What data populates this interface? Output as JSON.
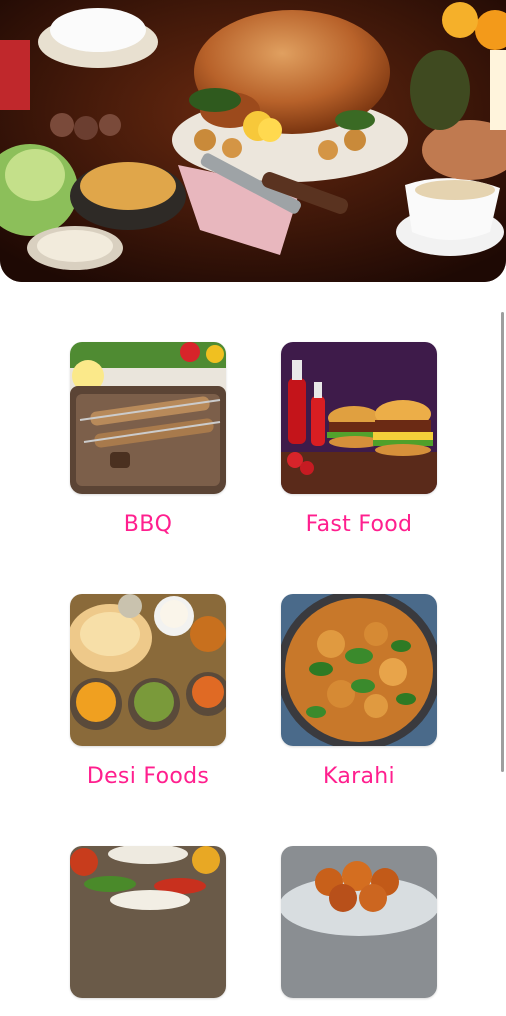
{
  "theme": {
    "accent": "#ff1f8e",
    "background": "#ffffff"
  },
  "hero": {
    "image": "holiday-feast-roast-turkey"
  },
  "categories": [
    {
      "label": "BBQ",
      "image": "bbq-skewers"
    },
    {
      "label": "Fast Food",
      "image": "burgers-and-ketchup"
    },
    {
      "label": "Desi Foods",
      "image": "naan-and-curries"
    },
    {
      "label": "Karahi",
      "image": "chicken-karahi"
    },
    {
      "label": "",
      "image": "spices-platter"
    },
    {
      "label": "",
      "image": "gulab-jamun"
    }
  ]
}
